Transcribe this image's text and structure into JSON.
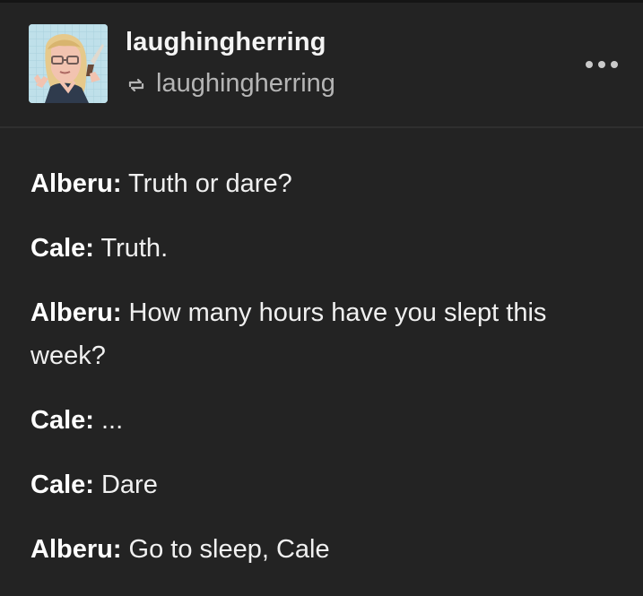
{
  "post": {
    "username": "laughingherring",
    "reblogged_from": "laughingherring",
    "icons": {
      "reblog": "reblog-icon",
      "more": "more-icon"
    },
    "dialogue": [
      {
        "speaker": "Alberu:",
        "text": " Truth or dare?"
      },
      {
        "speaker": "Cale:",
        "text": " Truth."
      },
      {
        "speaker": "Alberu:",
        "text": " How many hours have you slept this week?"
      },
      {
        "speaker": "Cale:",
        "text": " ..."
      },
      {
        "speaker": "Cale:",
        "text": " Dare"
      },
      {
        "speaker": "Alberu:",
        "text": " Go to sleep, Cale"
      }
    ]
  },
  "colors": {
    "background": "#232323",
    "text": "#f0f0f0",
    "muted": "#b5b5b5"
  }
}
